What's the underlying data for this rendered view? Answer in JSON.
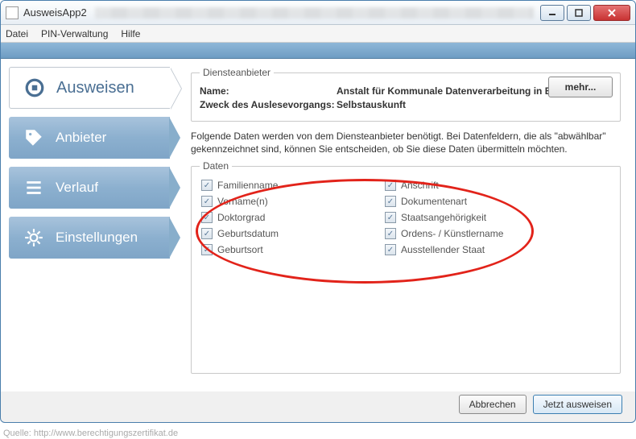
{
  "window": {
    "title": "AusweisApp2"
  },
  "menu": {
    "file": "Datei",
    "pin": "PIN-Verwaltung",
    "help": "Hilfe"
  },
  "sidebar": {
    "items": [
      {
        "key": "ausweisen",
        "label": "Ausweisen"
      },
      {
        "key": "anbieter",
        "label": "Anbieter"
      },
      {
        "key": "verlauf",
        "label": "Verlauf"
      },
      {
        "key": "einstellungen",
        "label": "Einstellungen"
      }
    ]
  },
  "provider": {
    "legend": "Diensteanbieter",
    "name_label": "Name:",
    "name_value": "Anstalt für Kommunale Datenverarbeitung in Bayern",
    "purpose_label": "Zweck des Auslesevorgangs:",
    "purpose_value": "Selbstauskunft",
    "more_button": "mehr..."
  },
  "instruction": "Folgende Daten werden von dem Diensteanbieter benötigt. Bei Datenfeldern, die als \"abwählbar\" gekennzeichnet sind, können Sie entscheiden, ob Sie diese Daten übermitteln möchten.",
  "data": {
    "legend": "Daten",
    "left": [
      "Familienname",
      "Vorname(n)",
      "Doktorgrad",
      "Geburtsdatum",
      "Geburtsort"
    ],
    "right": [
      "Anschrift",
      "Dokumentenart",
      "Staatsangehörigkeit",
      "Ordens- / Künstlername",
      "Ausstellender Staat"
    ]
  },
  "buttons": {
    "cancel": "Abbrechen",
    "submit": "Jetzt ausweisen"
  },
  "source": "Quelle: http://www.berechtigungszertifikat.de"
}
